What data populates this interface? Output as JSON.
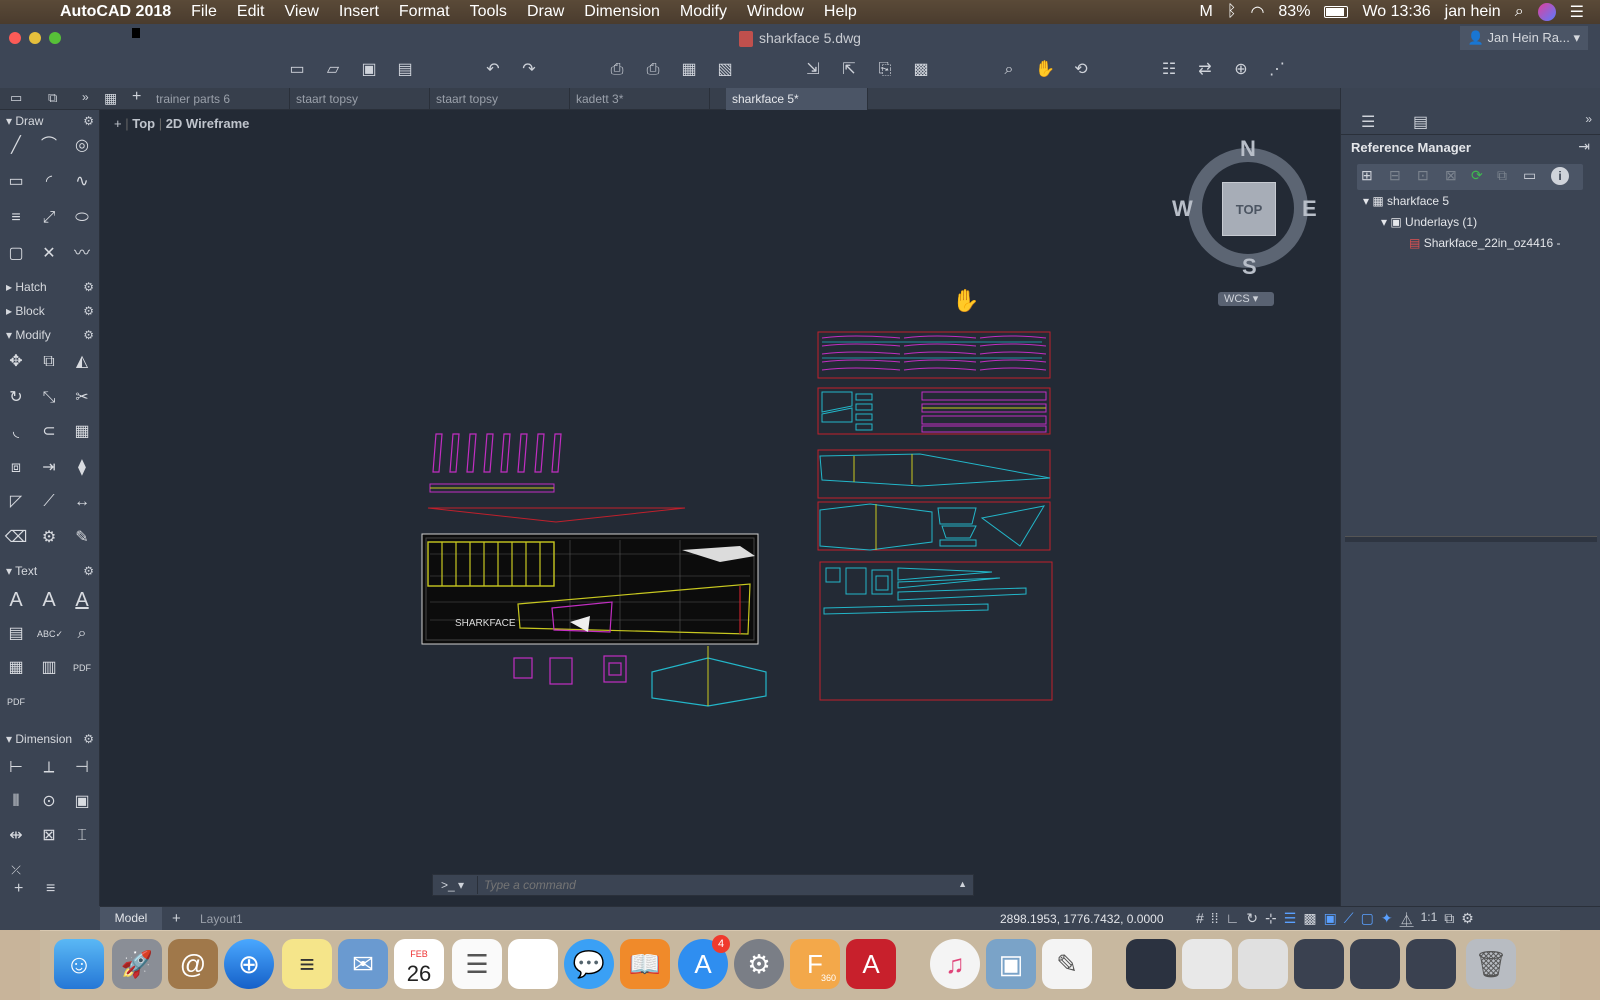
{
  "menubar": {
    "app": "AutoCAD 2018",
    "items": [
      "File",
      "Edit",
      "View",
      "Insert",
      "Format",
      "Tools",
      "Draw",
      "Dimension",
      "Modify",
      "Window",
      "Help"
    ],
    "battery": "83%",
    "clock": "Wo 13:36",
    "user": "jan hein"
  },
  "window": {
    "title": "sharkface 5.dwg",
    "account": "Jan Hein Ra..."
  },
  "tabs": [
    "trainer parts 6",
    "staart topsy",
    "staart topsy",
    "kadett 3*",
    "sharkface 5*"
  ],
  "viewport": {
    "view": "Top",
    "style": "2D Wireframe"
  },
  "palette": {
    "draw": "Draw",
    "hatch": "Hatch",
    "block": "Block",
    "modify": "Modify",
    "text": "Text",
    "dimension": "Dimension"
  },
  "viewcube": {
    "n": "N",
    "s": "S",
    "e": "E",
    "w": "W",
    "face": "TOP",
    "ucs": "WCS"
  },
  "reference_manager": {
    "title": "Reference Manager",
    "root": "sharkface 5",
    "group": "Underlays (1)",
    "file": "Sharkface_22in_oz4416 -"
  },
  "command": {
    "prompt": ">_",
    "placeholder": "Type a command"
  },
  "status": {
    "model_tab": "Model",
    "layout_tab": "Layout1",
    "coords": "2898.1953, 1776.7432, 0.0000",
    "scale": "1:1"
  },
  "plan_label": "SHARKFACE",
  "dock": {
    "calendar_month": "FEB",
    "calendar_day": "26",
    "appstore_badge": "4",
    "fusion_label": "360"
  },
  "colors": {
    "canvas": "#232a35",
    "magenta": "#c22ec2",
    "cyan": "#23b6c9",
    "red": "#c0202c",
    "yellow": "#c8c820"
  }
}
